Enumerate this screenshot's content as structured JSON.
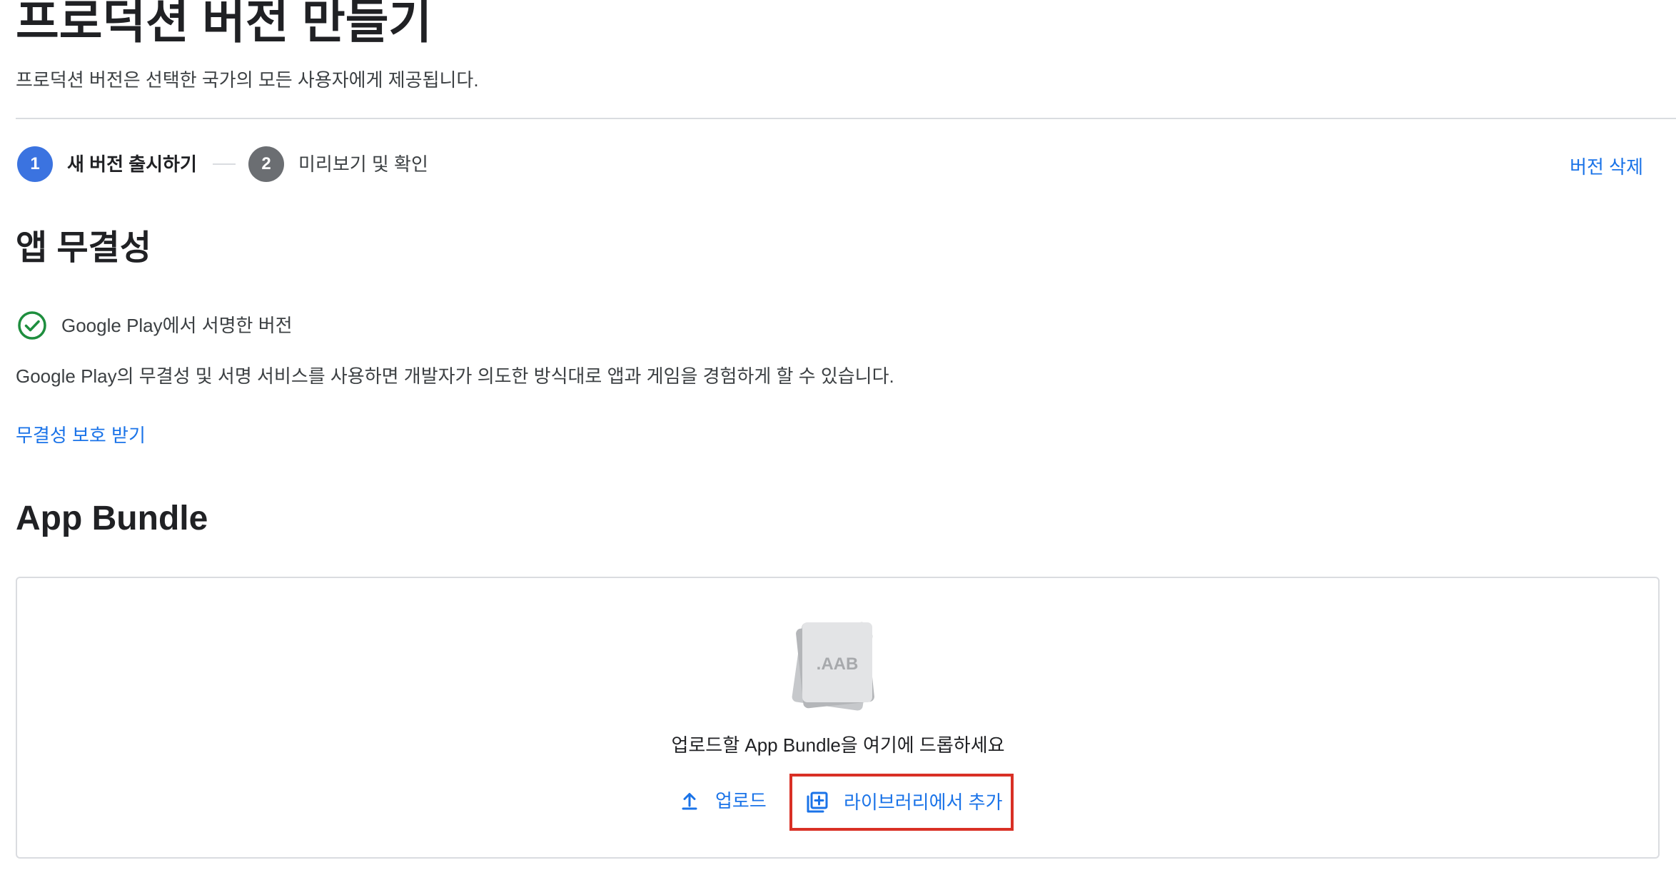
{
  "header": {
    "title": "프로덕션 버전 만들기",
    "subtitle": "프로덕션 버전은 선택한 국가의 모든 사용자에게 제공됩니다."
  },
  "stepper": {
    "steps": [
      {
        "number": "1",
        "label": "새 버전 출시하기",
        "state": "active"
      },
      {
        "number": "2",
        "label": "미리보기 및 확인",
        "state": "inactive"
      }
    ],
    "delete_label": "버전 삭제"
  },
  "integrity": {
    "heading": "앱 무결성",
    "status_text": "Google Play에서 서명한 버전",
    "status_icon": "check-circle-icon",
    "description": "Google Play의 무결성 및 서명 서비스를 사용하면 개발자가 의도한 방식대로 앱과 게임을 경험하게 할 수 있습니다.",
    "link_label": "무결성 보호 받기"
  },
  "bundle": {
    "heading": "App Bundle",
    "file_badge": ".AAB",
    "drop_text": "업로드할 App Bundle을 여기에 드롭하세요",
    "upload_label": "업로드",
    "upload_icon": "upload-icon",
    "library_label": "라이브러리에서 추가",
    "library_icon": "add-library-icon"
  },
  "colors": {
    "link": "#1a73e8",
    "active_step": "#3b73e0",
    "inactive_step": "#6b6e72",
    "success": "#1e8e3e",
    "highlight_border": "#d93025",
    "divider": "#dadce0"
  }
}
